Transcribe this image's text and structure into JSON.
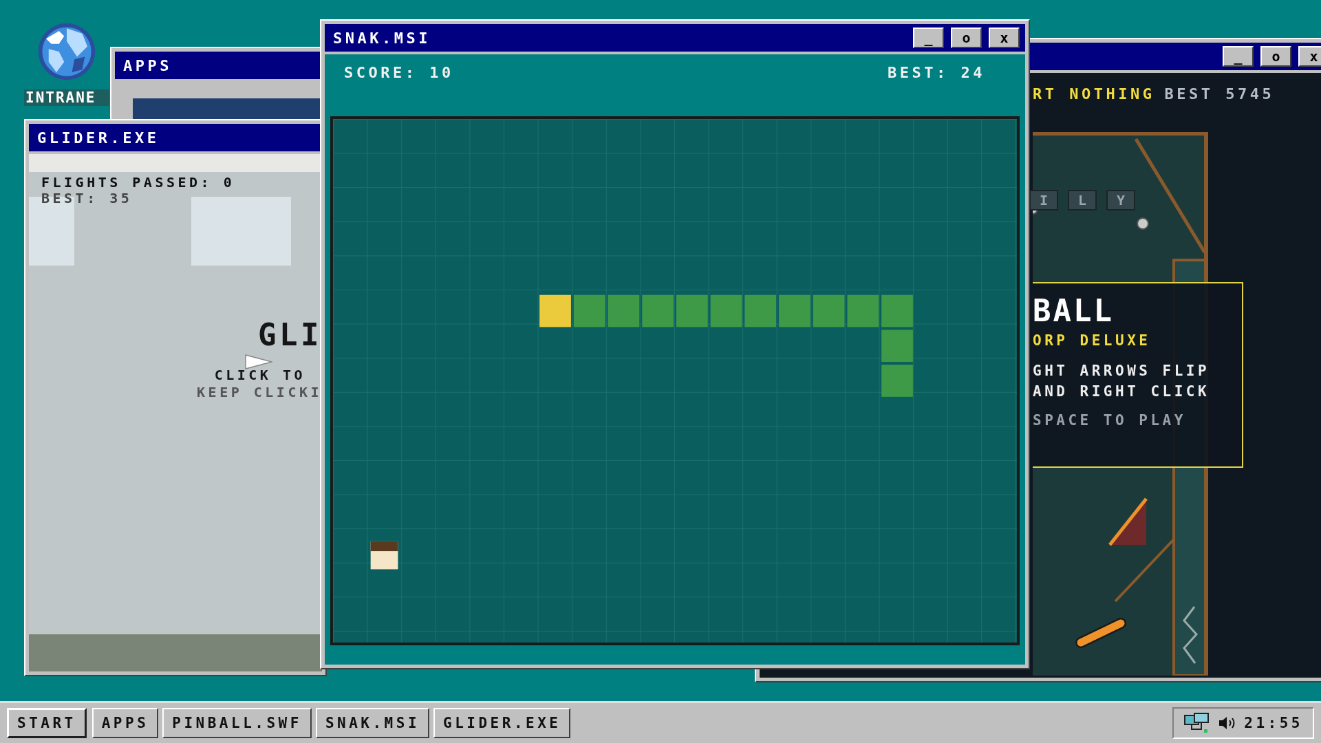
{
  "desktop_icons": [
    {
      "label": "INTRANE"
    }
  ],
  "apps_window": {
    "title": "APPS"
  },
  "glider_window": {
    "title": "GLIDER.EXE",
    "flights": "FLIGHTS PASSED: 0",
    "best": "BEST: 35",
    "game_title": "GLI",
    "prompt": "CLICK TO",
    "hint": "KEEP CLICKI"
  },
  "pinball_window": {
    "buttons": [
      "_",
      "o",
      "x"
    ],
    "status_left": "RT NOTHING",
    "status_right": "BEST 5745",
    "tiles": [
      "I",
      "L",
      "Y"
    ],
    "overlay": {
      "title": "BALL",
      "subtitle": "ORP DELUXE",
      "lines": [
        "GHT ARROWS FLIP",
        "AND RIGHT CLICK"
      ],
      "prompt": "SPACE TO PLAY"
    }
  },
  "snake_window": {
    "title": "SNAK.MSI",
    "buttons": [
      "_",
      "o",
      "x"
    ],
    "score": "SCORE: 10",
    "best": "BEST: 24"
  },
  "taskbar": {
    "items": [
      {
        "label": "START",
        "kind": "start"
      },
      {
        "label": "APPS",
        "kind": "task"
      },
      {
        "label": "PINBALL.SWF",
        "kind": "task"
      },
      {
        "label": "SNAK.MSI",
        "kind": "task"
      },
      {
        "label": "GLIDER.EXE",
        "kind": "task"
      }
    ],
    "clock": "21:55"
  }
}
